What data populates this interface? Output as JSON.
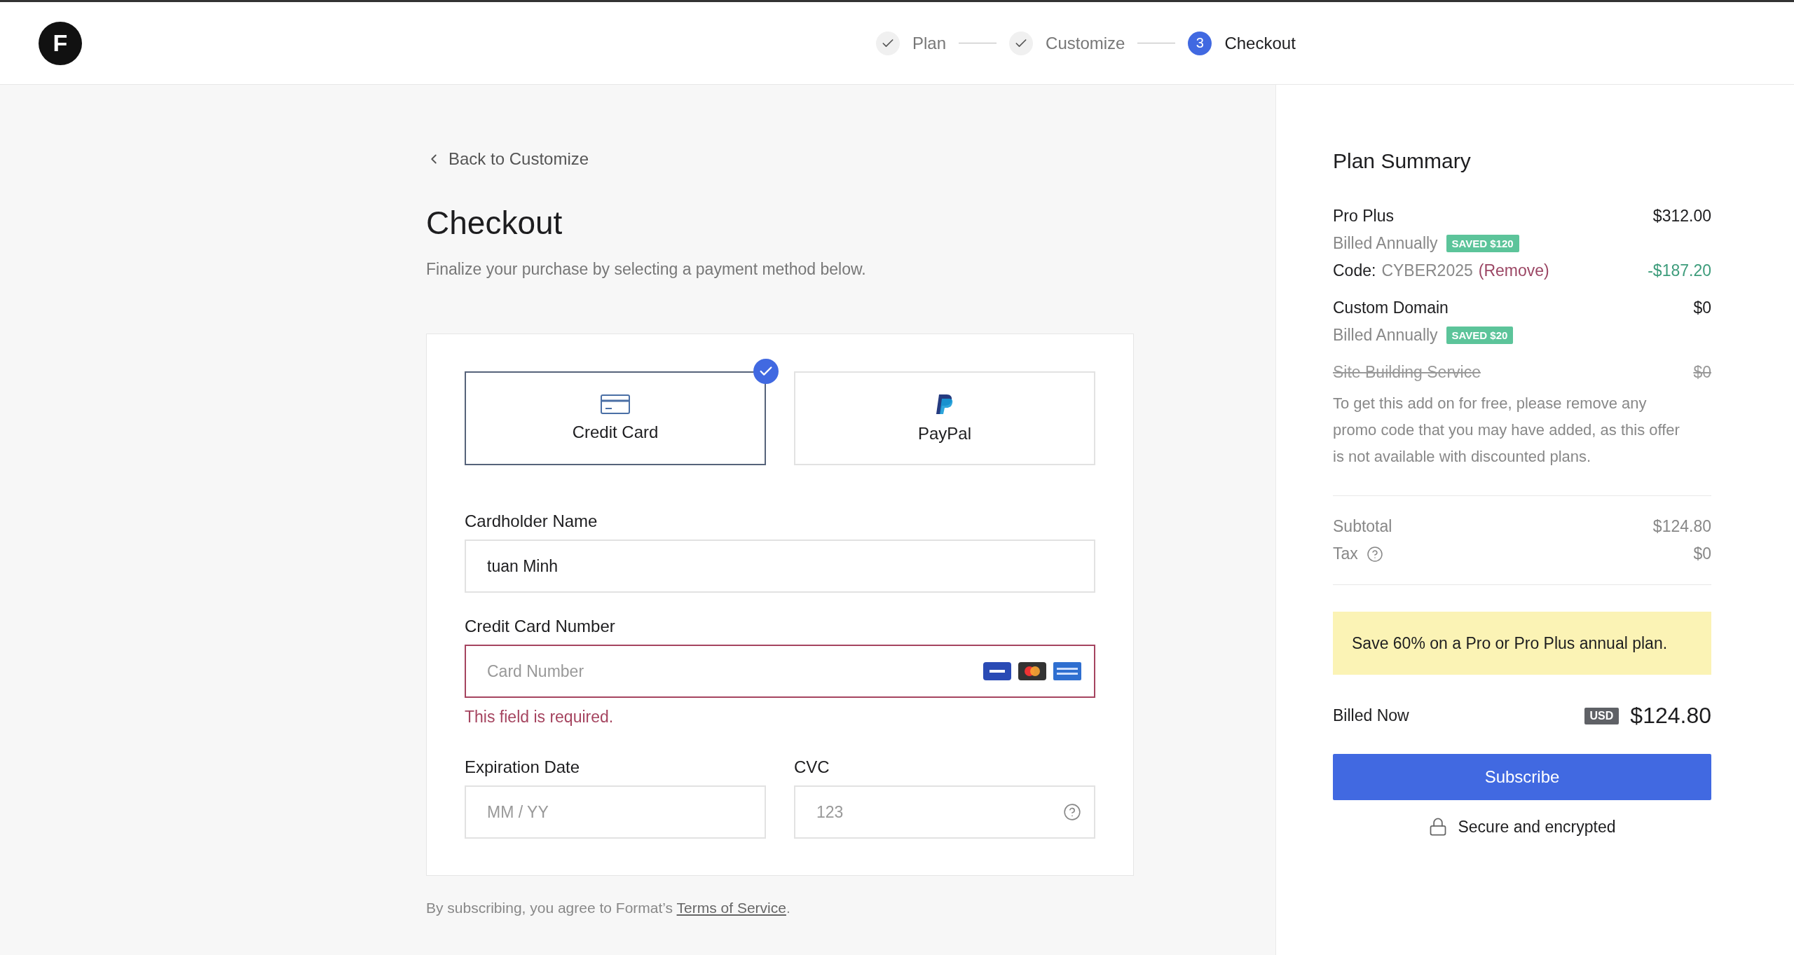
{
  "logo": {
    "letter": "F"
  },
  "steps": [
    {
      "label": "Plan",
      "completed": true,
      "selected": false
    },
    {
      "label": "Customize",
      "completed": true,
      "selected": false
    },
    {
      "label": "Checkout",
      "completed": false,
      "selected": true,
      "number": "3"
    }
  ],
  "back_link": "Back to Customize",
  "title": "Checkout",
  "subtitle": "Finalize your purchase by selecting a payment method below.",
  "payment_methods": [
    {
      "label": "Credit Card",
      "kind": "card",
      "selected": true
    },
    {
      "label": "PayPal",
      "kind": "paypal",
      "selected": false
    }
  ],
  "cardholder": {
    "label": "Cardholder Name",
    "value": "tuan Minh"
  },
  "card_number": {
    "label": "Credit Card Number",
    "placeholder": "Card Number",
    "error": "This field is required."
  },
  "expiration": {
    "label": "Expiration Date",
    "placeholder": "MM / YY"
  },
  "cvc": {
    "label": "CVC",
    "placeholder": "123"
  },
  "terms": {
    "before": "By subscribing, you agree to Format’s ",
    "link": "Terms of Service",
    "after": "."
  },
  "summary": {
    "title": "Plan Summary",
    "line_items": [
      {
        "name": "Pro Plus",
        "price": "$312.00",
        "struck": false,
        "billing": "Billed Annually",
        "badge": "SAVED $120",
        "promo": {
          "label": "Code:",
          "code": "CYBER2025",
          "action": "(Remove)",
          "amount": "-$187.20"
        }
      },
      {
        "name": "Custom Domain",
        "price": "$0",
        "struck": false,
        "billing": "Billed Annually",
        "badge": "SAVED $20"
      },
      {
        "name": "Site Building Service",
        "price": "$0",
        "struck": true,
        "note": "To get this add on for free, please remove any promo code that you may have added, as this offer is not available with discounted plans."
      }
    ],
    "totals": [
      {
        "label": "Subtotal",
        "value": "$124.80",
        "help": false
      },
      {
        "label": "Tax",
        "value": "$0",
        "help": true
      }
    ],
    "promo_banner": "Save 60% on a Pro or Pro Plus annual plan.",
    "billed_now": {
      "label": "Billed Now",
      "currency": "USD",
      "amount": "$124.80"
    },
    "subscribe_button": "Subscribe",
    "secure_note": "Secure and encrypted"
  }
}
